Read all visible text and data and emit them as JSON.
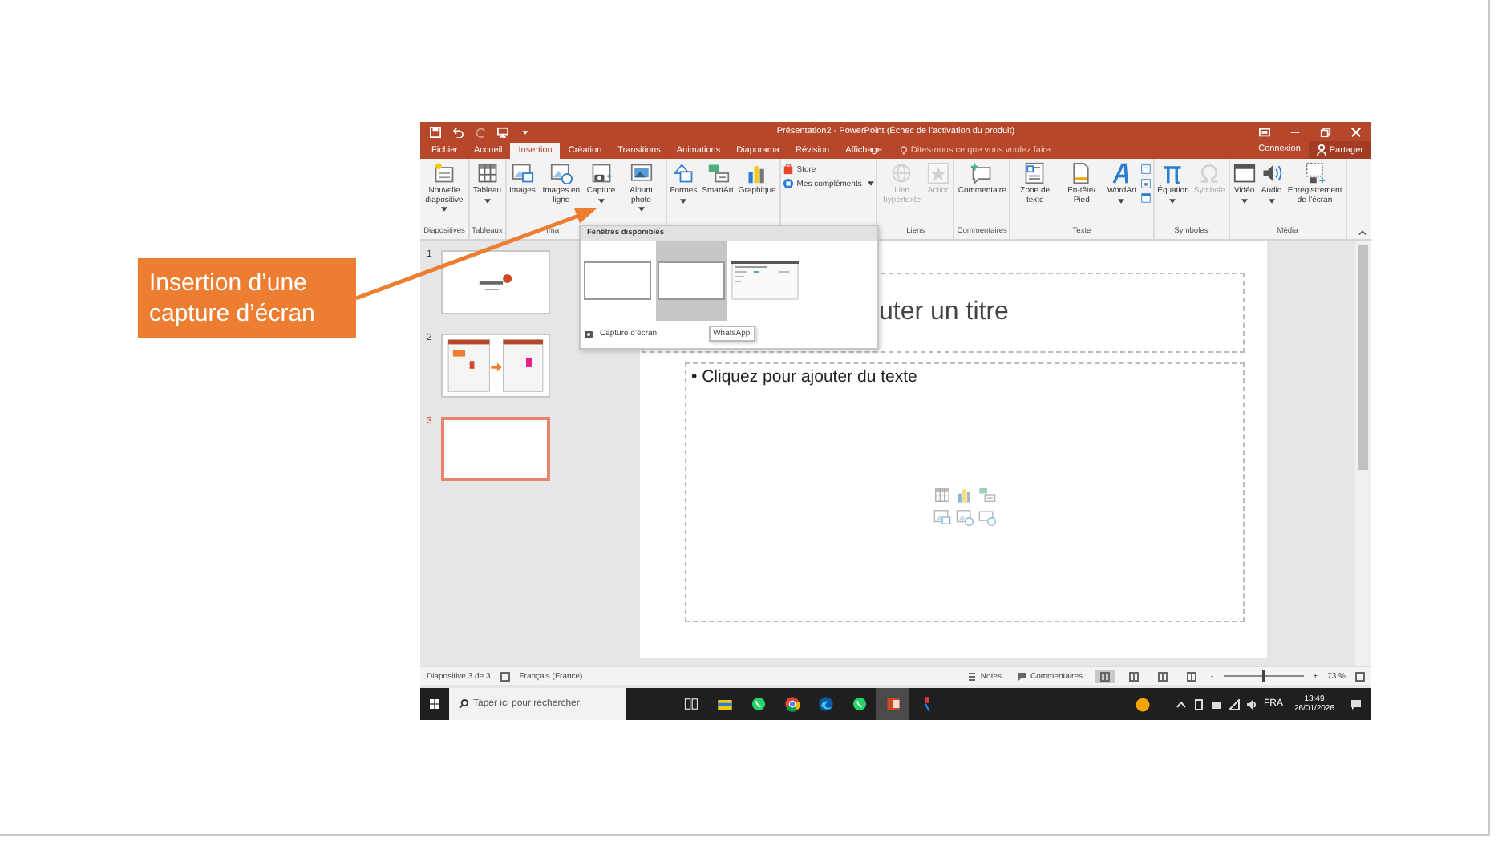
{
  "window": {
    "title": "Présentation2 - PowerPoint (Échec de l’activation du produit)"
  },
  "menu_tabs": [
    {
      "label": "Fichier",
      "selected": false
    },
    {
      "label": "Accueil",
      "selected": false
    },
    {
      "label": "Insertion",
      "selected": true
    },
    {
      "label": "Création",
      "selected": false
    },
    {
      "label": "Transitions",
      "selected": false
    },
    {
      "label": "Animations",
      "selected": false
    },
    {
      "label": "Diaporama",
      "selected": false
    },
    {
      "label": "Révision",
      "selected": false
    },
    {
      "label": "Affichage",
      "selected": false
    }
  ],
  "tell_me": {
    "placeholder": "Dites-nous ce que vous voulez faire."
  },
  "account": {
    "sign_in": "Connexion",
    "share": "Partager"
  },
  "ribbon": {
    "groups": [
      {
        "label": "Diapositives",
        "buttons": [
          {
            "label": "Nouvelle diapositive",
            "kind": "large",
            "dropdown": true,
            "disabled": false
          }
        ]
      },
      {
        "label": "Tableaux",
        "buttons": [
          {
            "label": "Tableau",
            "kind": "large",
            "dropdown": true,
            "disabled": false
          }
        ]
      },
      {
        "label": "Ima",
        "buttons": [
          {
            "label": "Images",
            "kind": "large",
            "dropdown": false,
            "disabled": false
          },
          {
            "label": "Images en ligne",
            "kind": "large",
            "dropdown": false,
            "disabled": false
          },
          {
            "label": "Capture",
            "kind": "large",
            "dropdown": true,
            "disabled": false
          },
          {
            "label": "Album photo",
            "kind": "large",
            "dropdown": true,
            "disabled": false
          }
        ]
      },
      {
        "buttons": [
          {
            "label": "Formes",
            "kind": "large",
            "dropdown": true,
            "disabled": false
          },
          {
            "label": "SmartArt",
            "kind": "large",
            "dropdown": false,
            "disabled": false
          },
          {
            "label": "Graphique",
            "kind": "large",
            "dropdown": false,
            "disabled": false
          }
        ]
      },
      {
        "buttons": [
          {
            "label": "Store",
            "kind": "small",
            "dropdown": false,
            "disabled": false
          },
          {
            "label": "Mes compléments",
            "kind": "small",
            "dropdown": true,
            "disabled": false
          }
        ]
      },
      {
        "label": "Liens",
        "buttons": [
          {
            "label": "Lien hypertexte",
            "kind": "large",
            "dropdown": false,
            "disabled": true
          },
          {
            "label": "Action",
            "kind": "large",
            "dropdown": false,
            "disabled": true
          }
        ]
      },
      {
        "label": "Commentaires",
        "buttons": [
          {
            "label": "Commentaire",
            "kind": "large",
            "dropdown": false,
            "disabled": false
          }
        ]
      },
      {
        "label": "Texte",
        "buttons": [
          {
            "label": "Zone de texte",
            "kind": "large",
            "dropdown": false,
            "disabled": false
          },
          {
            "label": "En-tête/ Pied",
            "kind": "large",
            "dropdown": false,
            "disabled": false
          },
          {
            "label": "WordArt",
            "kind": "large",
            "dropdown": true,
            "disabled": false
          },
          {
            "kind": "icon",
            "dropdown": false,
            "disabled": false
          },
          {
            "kind": "icon",
            "dropdown": false,
            "disabled": false
          },
          {
            "kind": "icon",
            "dropdown": false,
            "disabled": false
          }
        ]
      },
      {
        "label": "Symboles",
        "buttons": [
          {
            "label": "Équation",
            "kind": "large",
            "dropdown": true,
            "disabled": false
          },
          {
            "label": "Symbole",
            "kind": "large",
            "dropdown": false,
            "disabled": true
          }
        ]
      },
      {
        "label": "Média",
        "buttons": [
          {
            "label": "Vidéo",
            "kind": "large",
            "dropdown": true,
            "disabled": false
          },
          {
            "label": "Audio",
            "kind": "large",
            "dropdown": true,
            "disabled": false
          },
          {
            "label": "Enregistrement de l’écran",
            "kind": "large",
            "dropdown": false,
            "disabled": false
          }
        ]
      }
    ]
  },
  "screenshot_menu": {
    "header": "Fenêtres disponibles",
    "windows": [
      {
        "kind": "blank",
        "selected": false
      },
      {
        "kind": "blank",
        "selected": true
      },
      {
        "kind": "screenshot",
        "selected": false
      }
    ],
    "command": "Capture d’écran",
    "tooltip": "WhatsApp"
  },
  "slides": [
    {
      "number": "1",
      "kind": "title",
      "selected": false
    },
    {
      "number": "2",
      "kind": "diagram",
      "selected": false
    },
    {
      "number": "3",
      "kind": "blank",
      "selected": true
    }
  ],
  "slide": {
    "title_placeholder": "uter un titre",
    "body_placeholder": "• Cliquez pour ajouter du texte"
  },
  "status_bar": {
    "slide_position": "Diapositive 3 de 3",
    "language": "Français (France)",
    "notes": "Notes",
    "comments": "Commentaires",
    "views": [
      {
        "selected": true
      },
      {
        "selected": false
      },
      {
        "selected": false
      },
      {
        "selected": false
      }
    ],
    "zoom": {
      "minus": "-",
      "plus": "+",
      "level": 0.5,
      "reading": "73 %"
    }
  },
  "taskbar": {
    "search": {
      "placeholder": "Taper ici pour rechercher"
    },
    "apps": [
      {
        "selected": false
      },
      {
        "selected": false
      },
      {
        "selected": false
      },
      {
        "selected": false
      },
      {
        "selected": false
      },
      {
        "selected": false
      },
      {
        "selected": true
      },
      {
        "selected": false
      }
    ],
    "language": "FRA",
    "time": "13:49",
    "date": "26/01/2026"
  },
  "callout": {
    "text": "Insertion d’une capture d’écran"
  }
}
